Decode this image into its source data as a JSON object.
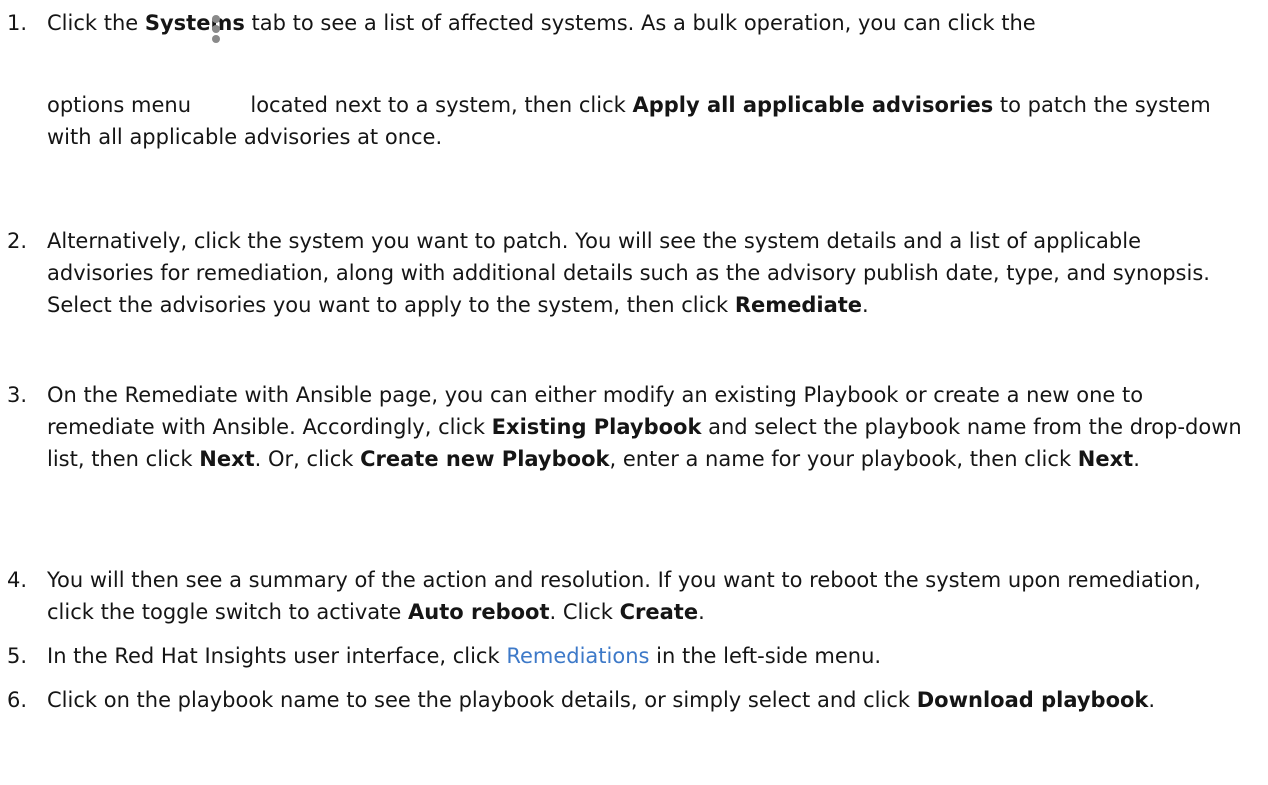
{
  "steps": [
    {
      "num": "1.",
      "parts": {
        "a": "Click the ",
        "b": "Systems",
        "c": " tab to see a list of affected systems. As a bulk operation, you can click the",
        "d": "options menu ",
        "e": " located next to a system, then click ",
        "f": "Apply all applicable advisories",
        "g": " to patch the system with all applicable advisories at once."
      },
      "icon": "kebab-menu-icon"
    },
    {
      "num": "2.",
      "parts": {
        "a": "Alternatively, click the system you want to patch. You will see the system details and a list of applicable advisories for remediation, along with additional details such as the advisory publish date, type, and synopsis. Select the advisories you want to apply to the system, then click ",
        "b": "Remediate",
        "c": "."
      }
    },
    {
      "num": "3.",
      "parts": {
        "a": "On the Remediate with Ansible page, you can either modify an existing Playbook or create a new one to remediate with Ansible. Accordingly, click ",
        "b": "Existing Playbook",
        "c": " and select the playbook name from the drop-down list, then click ",
        "d": "Next",
        "e": ". Or, click ",
        "f": "Create new Playbook",
        "g": ", enter a name for your playbook, then click ",
        "h": "Next",
        "i": "."
      }
    },
    {
      "num": "4.",
      "parts": {
        "a": "You will then see a summary of the action and resolution. If you want to reboot the system upon remediation, click the toggle switch to activate ",
        "b": "Auto reboot",
        "c": ". Click ",
        "d": "Create",
        "e": "."
      }
    },
    {
      "num": "5.",
      "parts": {
        "a": "In the Red Hat Insights user interface, click ",
        "b": "Remediations",
        "c": " in the left-side menu."
      },
      "link_color": "#3d79c8"
    },
    {
      "num": "6.",
      "parts": {
        "a": "Click on the playbook name to see the playbook details, or simply select and click ",
        "b": "Download playbook",
        "c": "."
      }
    }
  ]
}
